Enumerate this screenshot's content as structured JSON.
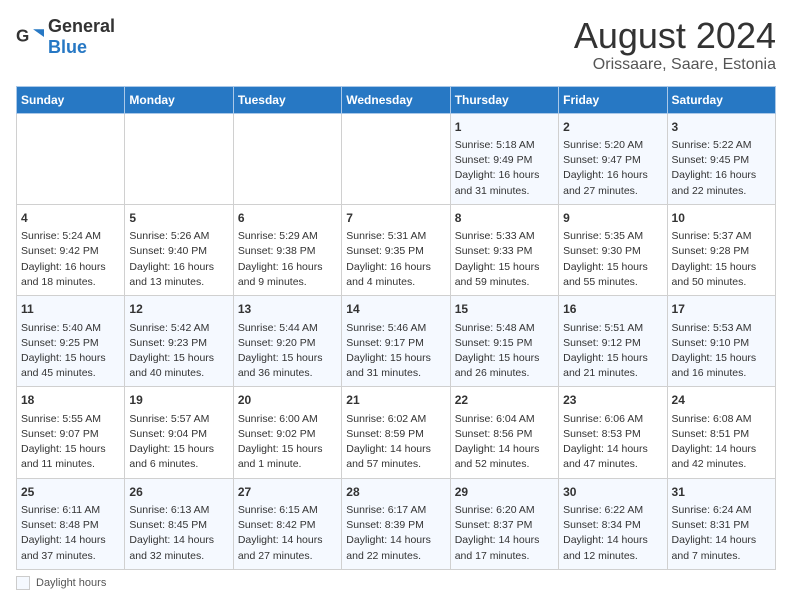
{
  "header": {
    "logo_general": "General",
    "logo_blue": "Blue",
    "title": "August 2024",
    "subtitle": "Orissaare, Saare, Estonia"
  },
  "days_of_week": [
    "Sunday",
    "Monday",
    "Tuesday",
    "Wednesday",
    "Thursday",
    "Friday",
    "Saturday"
  ],
  "weeks": [
    [
      {
        "day": "",
        "text": ""
      },
      {
        "day": "",
        "text": ""
      },
      {
        "day": "",
        "text": ""
      },
      {
        "day": "",
        "text": ""
      },
      {
        "day": "1",
        "text": "Sunrise: 5:18 AM\nSunset: 9:49 PM\nDaylight: 16 hours and 31 minutes."
      },
      {
        "day": "2",
        "text": "Sunrise: 5:20 AM\nSunset: 9:47 PM\nDaylight: 16 hours and 27 minutes."
      },
      {
        "day": "3",
        "text": "Sunrise: 5:22 AM\nSunset: 9:45 PM\nDaylight: 16 hours and 22 minutes."
      }
    ],
    [
      {
        "day": "4",
        "text": "Sunrise: 5:24 AM\nSunset: 9:42 PM\nDaylight: 16 hours and 18 minutes."
      },
      {
        "day": "5",
        "text": "Sunrise: 5:26 AM\nSunset: 9:40 PM\nDaylight: 16 hours and 13 minutes."
      },
      {
        "day": "6",
        "text": "Sunrise: 5:29 AM\nSunset: 9:38 PM\nDaylight: 16 hours and 9 minutes."
      },
      {
        "day": "7",
        "text": "Sunrise: 5:31 AM\nSunset: 9:35 PM\nDaylight: 16 hours and 4 minutes."
      },
      {
        "day": "8",
        "text": "Sunrise: 5:33 AM\nSunset: 9:33 PM\nDaylight: 15 hours and 59 minutes."
      },
      {
        "day": "9",
        "text": "Sunrise: 5:35 AM\nSunset: 9:30 PM\nDaylight: 15 hours and 55 minutes."
      },
      {
        "day": "10",
        "text": "Sunrise: 5:37 AM\nSunset: 9:28 PM\nDaylight: 15 hours and 50 minutes."
      }
    ],
    [
      {
        "day": "11",
        "text": "Sunrise: 5:40 AM\nSunset: 9:25 PM\nDaylight: 15 hours and 45 minutes."
      },
      {
        "day": "12",
        "text": "Sunrise: 5:42 AM\nSunset: 9:23 PM\nDaylight: 15 hours and 40 minutes."
      },
      {
        "day": "13",
        "text": "Sunrise: 5:44 AM\nSunset: 9:20 PM\nDaylight: 15 hours and 36 minutes."
      },
      {
        "day": "14",
        "text": "Sunrise: 5:46 AM\nSunset: 9:17 PM\nDaylight: 15 hours and 31 minutes."
      },
      {
        "day": "15",
        "text": "Sunrise: 5:48 AM\nSunset: 9:15 PM\nDaylight: 15 hours and 26 minutes."
      },
      {
        "day": "16",
        "text": "Sunrise: 5:51 AM\nSunset: 9:12 PM\nDaylight: 15 hours and 21 minutes."
      },
      {
        "day": "17",
        "text": "Sunrise: 5:53 AM\nSunset: 9:10 PM\nDaylight: 15 hours and 16 minutes."
      }
    ],
    [
      {
        "day": "18",
        "text": "Sunrise: 5:55 AM\nSunset: 9:07 PM\nDaylight: 15 hours and 11 minutes."
      },
      {
        "day": "19",
        "text": "Sunrise: 5:57 AM\nSunset: 9:04 PM\nDaylight: 15 hours and 6 minutes."
      },
      {
        "day": "20",
        "text": "Sunrise: 6:00 AM\nSunset: 9:02 PM\nDaylight: 15 hours and 1 minute."
      },
      {
        "day": "21",
        "text": "Sunrise: 6:02 AM\nSunset: 8:59 PM\nDaylight: 14 hours and 57 minutes."
      },
      {
        "day": "22",
        "text": "Sunrise: 6:04 AM\nSunset: 8:56 PM\nDaylight: 14 hours and 52 minutes."
      },
      {
        "day": "23",
        "text": "Sunrise: 6:06 AM\nSunset: 8:53 PM\nDaylight: 14 hours and 47 minutes."
      },
      {
        "day": "24",
        "text": "Sunrise: 6:08 AM\nSunset: 8:51 PM\nDaylight: 14 hours and 42 minutes."
      }
    ],
    [
      {
        "day": "25",
        "text": "Sunrise: 6:11 AM\nSunset: 8:48 PM\nDaylight: 14 hours and 37 minutes."
      },
      {
        "day": "26",
        "text": "Sunrise: 6:13 AM\nSunset: 8:45 PM\nDaylight: 14 hours and 32 minutes."
      },
      {
        "day": "27",
        "text": "Sunrise: 6:15 AM\nSunset: 8:42 PM\nDaylight: 14 hours and 27 minutes."
      },
      {
        "day": "28",
        "text": "Sunrise: 6:17 AM\nSunset: 8:39 PM\nDaylight: 14 hours and 22 minutes."
      },
      {
        "day": "29",
        "text": "Sunrise: 6:20 AM\nSunset: 8:37 PM\nDaylight: 14 hours and 17 minutes."
      },
      {
        "day": "30",
        "text": "Sunrise: 6:22 AM\nSunset: 8:34 PM\nDaylight: 14 hours and 12 minutes."
      },
      {
        "day": "31",
        "text": "Sunrise: 6:24 AM\nSunset: 8:31 PM\nDaylight: 14 hours and 7 minutes."
      }
    ]
  ],
  "footer": {
    "legend_label": "Daylight hours"
  }
}
